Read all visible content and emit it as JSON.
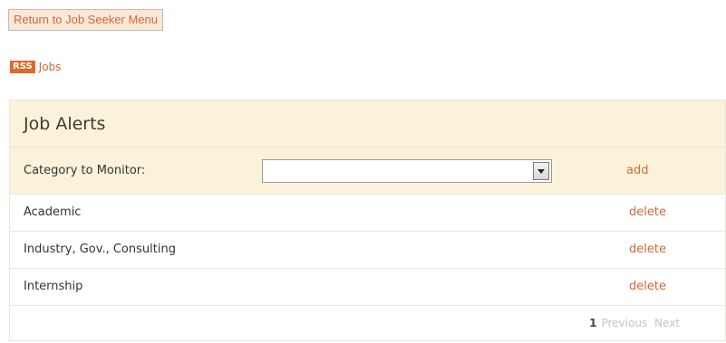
{
  "header": {
    "return_label": "Return to Job Seeker Menu"
  },
  "rss": {
    "badge": "RSS",
    "link": "Jobs"
  },
  "panel": {
    "title": "Job Alerts",
    "monitor_label": "Category to Monitor:",
    "select_value": "",
    "add_label": "add"
  },
  "alerts": [
    {
      "name": "Academic",
      "action": "delete"
    },
    {
      "name": "Industry, Gov., Consulting",
      "action": "delete"
    },
    {
      "name": "Internship",
      "action": "delete"
    }
  ],
  "pager": {
    "current": "1",
    "previous": "Previous",
    "next": "Next"
  },
  "colors": {
    "accent": "#d2683a",
    "rss_orange": "#e0682b",
    "panel_bg": "#fbf3d9"
  },
  "icons": {
    "select": "chevron-down-icon"
  }
}
